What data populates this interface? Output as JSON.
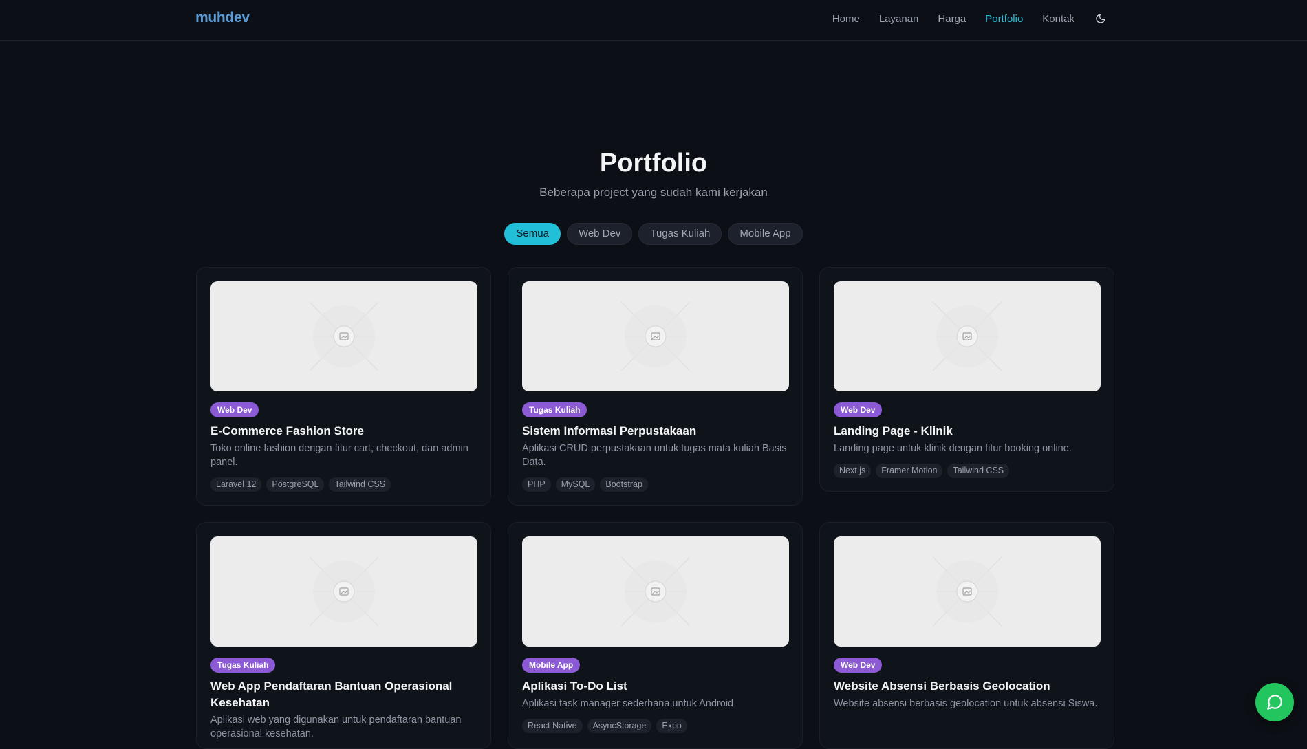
{
  "brand": {
    "name": "muhdev"
  },
  "nav": {
    "items": [
      {
        "label": "Home",
        "active": false
      },
      {
        "label": "Layanan",
        "active": false
      },
      {
        "label": "Harga",
        "active": false
      },
      {
        "label": "Portfolio",
        "active": true
      },
      {
        "label": "Kontak",
        "active": false
      }
    ],
    "theme_toggle_icon": "moon-icon"
  },
  "hero": {
    "title": "Portfolio",
    "subtitle": "Beberapa project yang sudah kami kerjakan"
  },
  "filters": [
    {
      "label": "Semua",
      "active": true
    },
    {
      "label": "Web Dev",
      "active": false
    },
    {
      "label": "Tugas Kuliah",
      "active": false
    },
    {
      "label": "Mobile App",
      "active": false
    }
  ],
  "projects": [
    {
      "category": "Web Dev",
      "title": "E-Commerce Fashion Store",
      "description": "Toko online fashion dengan fitur cart, checkout, dan admin panel.",
      "tags": [
        "Laravel 12",
        "PostgreSQL",
        "Tailwind CSS"
      ]
    },
    {
      "category": "Tugas Kuliah",
      "title": "Sistem Informasi Perpustakaan",
      "description": "Aplikasi CRUD perpustakaan untuk tugas mata kuliah Basis Data.",
      "tags": [
        "PHP",
        "MySQL",
        "Bootstrap"
      ]
    },
    {
      "category": "Web Dev",
      "title": "Landing Page - Klinik",
      "description": "Landing page untuk klinik dengan fitur booking online.",
      "tags": [
        "Next.js",
        "Framer Motion",
        "Tailwind CSS"
      ]
    },
    {
      "category": "Tugas Kuliah",
      "title": "Web App Pendaftaran Bantuan Operasional Kesehatan",
      "description": "Aplikasi web yang digunakan untuk pendaftaran bantuan operasional kesehatan.",
      "tags": []
    },
    {
      "category": "Mobile App",
      "title": "Aplikasi To-Do List",
      "description": "Aplikasi task manager sederhana untuk Android",
      "tags": [
        "React Native",
        "AsyncStorage",
        "Expo"
      ]
    },
    {
      "category": "Web Dev",
      "title": "Website Absensi Berbasis Geolocation",
      "description": "Website absensi berbasis geolocation untuk absensi Siswa.",
      "tags": []
    }
  ],
  "colors": {
    "accent": "#22c0d8",
    "badge": "#8b5ad4",
    "background": "#0c0f15",
    "chat_button": "#22c55e"
  },
  "chat_button_icon": "chat-bubble-icon",
  "thumbnail_icon": "image-placeholder-icon"
}
